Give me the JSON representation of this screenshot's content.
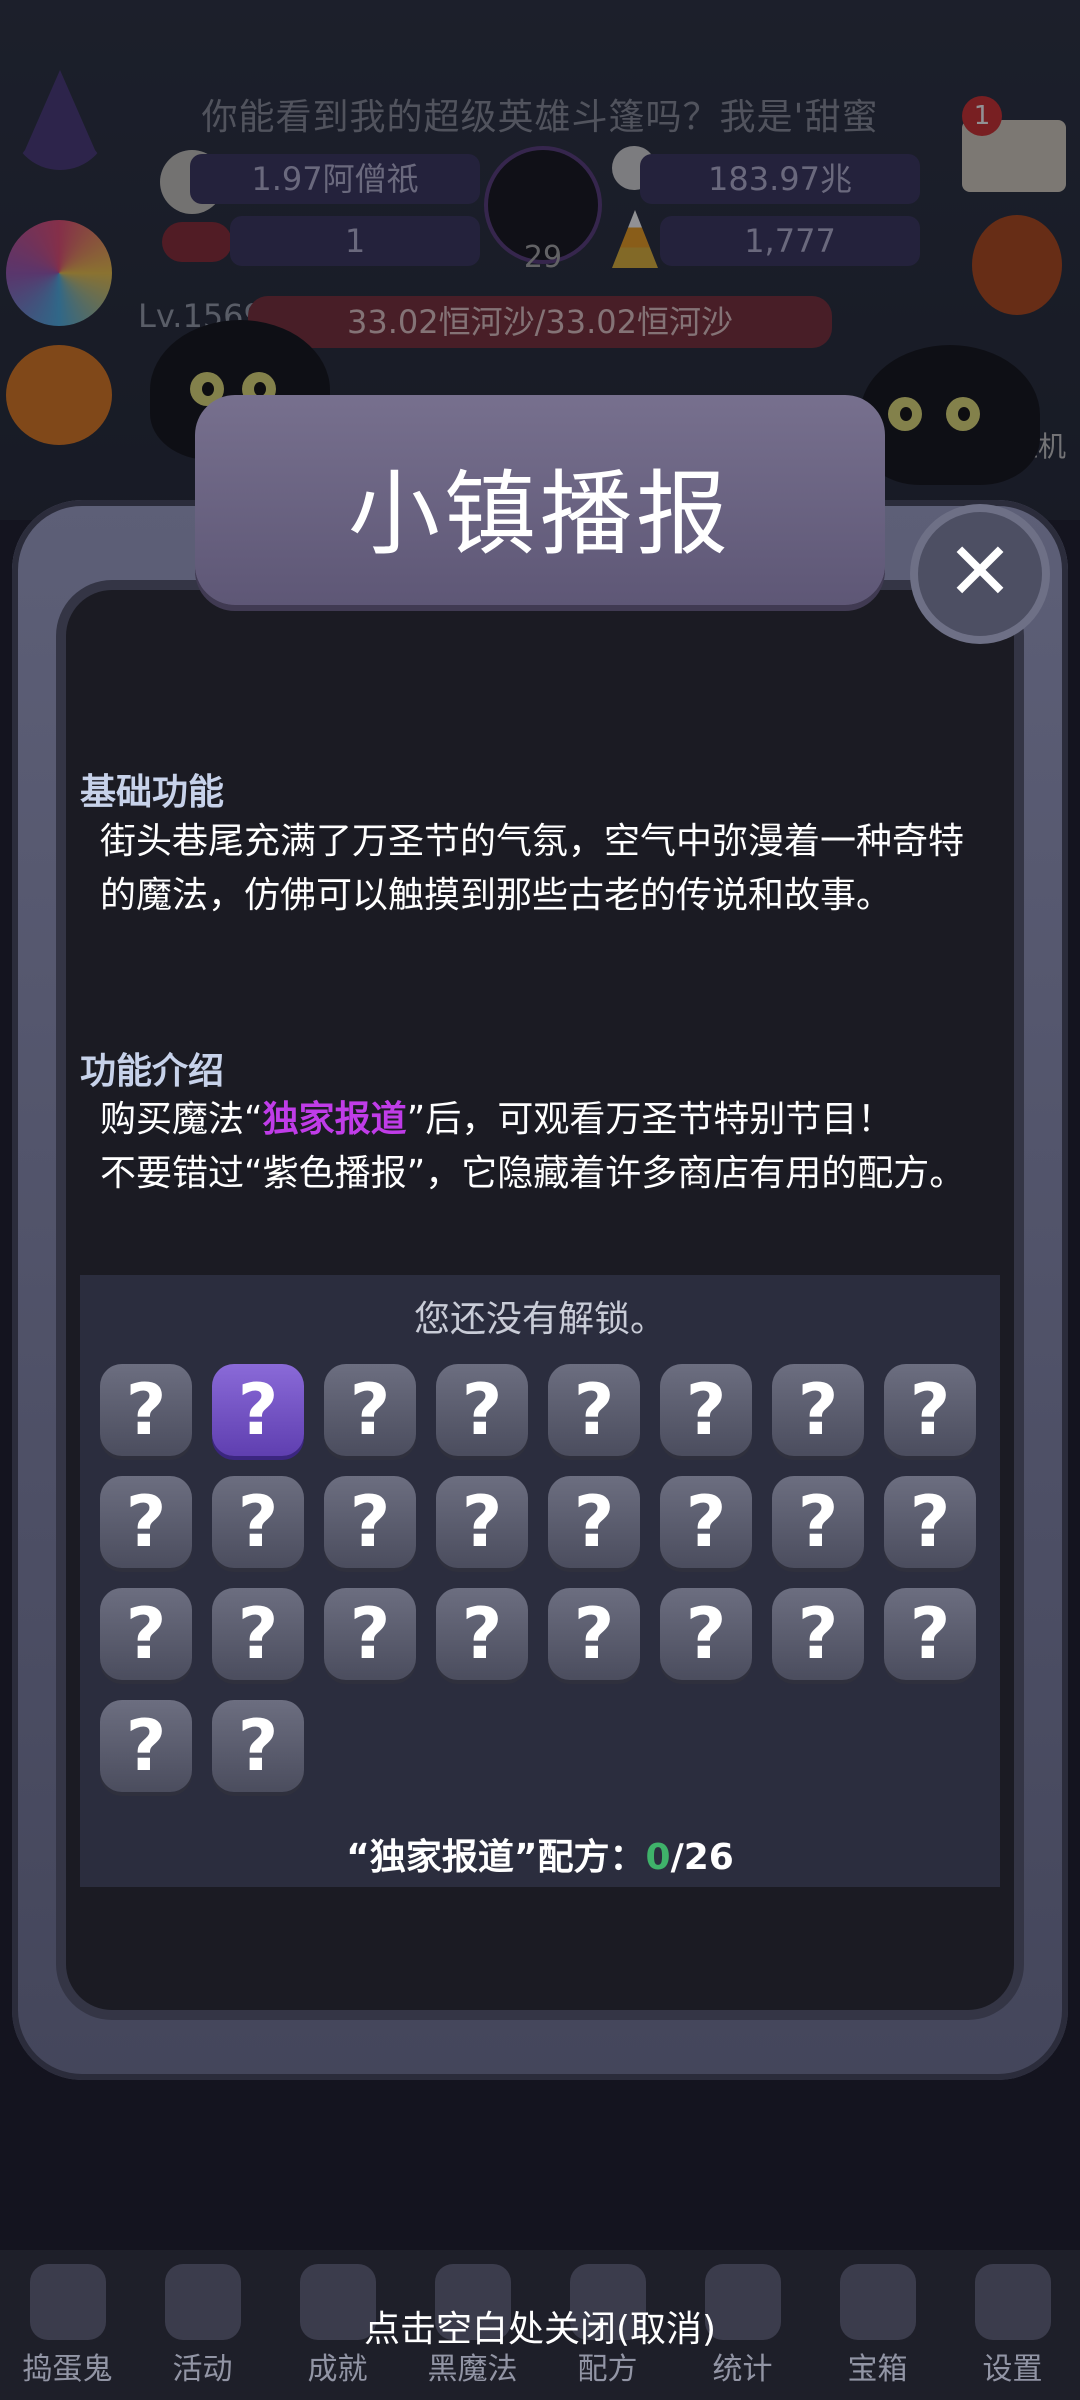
{
  "hud": {
    "marquee": "你能看到我的超级英雄斗篷吗？我是'甜蜜",
    "res_1": "1.97阿僧祇",
    "res_2": "183.97兆",
    "res_3": "1",
    "res_4": "1,777",
    "cauldron_count": "29",
    "level": "Lv.1569",
    "hp": "33.02恒河沙/33.02恒河沙",
    "notification_count": "1",
    "side_tag": "挂机"
  },
  "modal": {
    "title": "小镇播报",
    "section1_title": "基础功能",
    "section1_body": "街头巷尾充满了万圣节的气氛，空气中弥漫着一种奇特的魔法，仿佛可以触摸到那些古老的传说和故事。",
    "section2_title": "功能介绍",
    "section2_line1_pre": "购买魔法“",
    "section2_line1_hl": "独家报道",
    "section2_line1_post": "”后，可观看万圣节特别节目！",
    "section2_line2": "不要错过“紫色播报”，它隐藏着许多商店有用的配方。",
    "unlock_message": "您还没有解锁。",
    "question_mark": "?",
    "recipe_label": "“独家报道”配方：",
    "recipe_have": "0",
    "recipe_sep": "/",
    "recipe_total": "26"
  },
  "recipes": {
    "total": 26,
    "active_index": 1
  },
  "close_hint": "点击空白处关闭(取消)",
  "nav": [
    {
      "label": "捣蛋鬼",
      "icon": "ghost-icon"
    },
    {
      "label": "活动",
      "icon": "activity-icon"
    },
    {
      "label": "成就",
      "icon": "trophy-icon"
    },
    {
      "label": "黑魔法",
      "icon": "hat-icon"
    },
    {
      "label": "配方",
      "icon": "recipe-icon"
    },
    {
      "label": "统计",
      "icon": "crystal-ball-icon"
    },
    {
      "label": "宝箱",
      "icon": "chest-icon"
    },
    {
      "label": "设置",
      "icon": "gear-icon"
    }
  ],
  "colors": {
    "accent_purple": "#c03ce8",
    "have_green": "#3fb26a",
    "panel": "#2b2d3e"
  }
}
